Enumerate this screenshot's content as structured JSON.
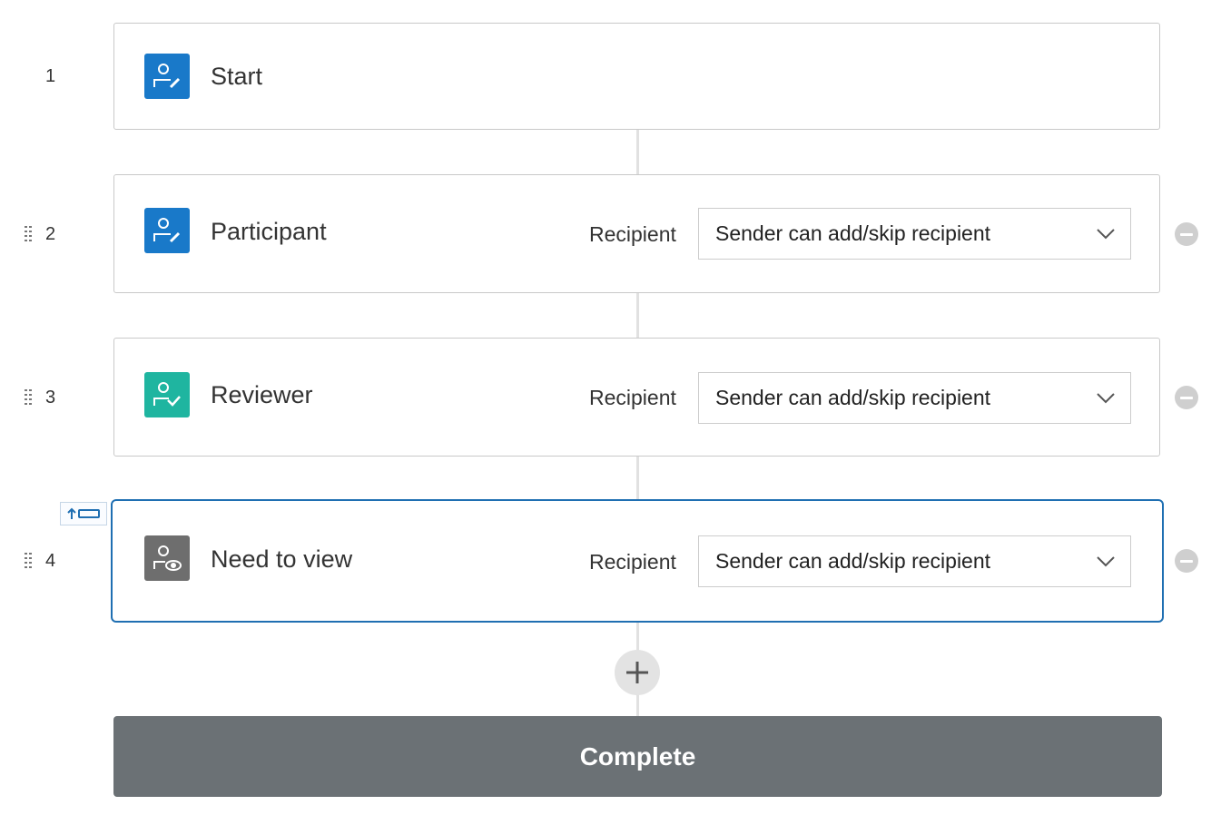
{
  "steps": [
    {
      "number": "1",
      "title": "Start",
      "icon": "user-edit-icon",
      "icon_color": "#1979c9"
    },
    {
      "number": "2",
      "title": "Participant",
      "icon": "user-edit-icon",
      "icon_color": "#1979c9",
      "recipient_label": "Recipient",
      "recipient_value": "Sender can add/skip recipient"
    },
    {
      "number": "3",
      "title": "Reviewer",
      "icon": "user-check-icon",
      "icon_color": "#1fb5a0",
      "recipient_label": "Recipient",
      "recipient_value": "Sender can add/skip recipient"
    },
    {
      "number": "4",
      "title": "Need to view",
      "icon": "user-view-icon",
      "icon_color": "#6e6e6e",
      "recipient_label": "Recipient",
      "recipient_value": "Sender can add/skip recipient",
      "selected": true
    }
  ],
  "actions": {
    "complete_label": "Complete"
  },
  "colors": {
    "selected_border": "#1f6fb2",
    "complete_button": "#6b7175"
  }
}
